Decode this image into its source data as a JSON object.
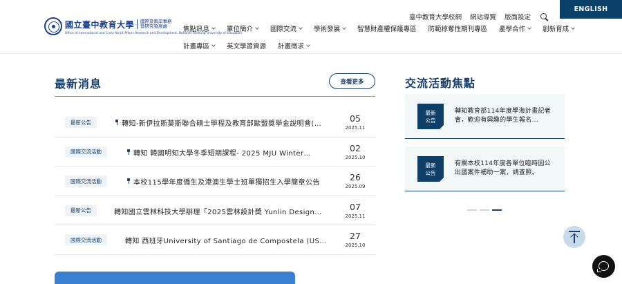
{
  "header": {
    "logo": {
      "name_cn": "國立臺中教育大學",
      "sub_line1": "國際及兩岸事務",
      "sub_line2": "暨研究發展處",
      "name_en": "Office of International and Cross-Strait Affairs Research and Development, National Taichung University of Education"
    },
    "utility_links": [
      "臺中教育大學校網",
      "網站導覽",
      "版面設定"
    ],
    "search_icon": "search-icon",
    "english_label": "ENGLISH",
    "nav_row1": [
      {
        "label": "焦點訊息",
        "dropdown": true
      },
      {
        "label": "單位簡介",
        "dropdown": true
      },
      {
        "label": "國際交流",
        "dropdown": true
      },
      {
        "label": "學術發展",
        "dropdown": true
      },
      {
        "label": "智慧財產權保護專區",
        "dropdown": false
      },
      {
        "label": "防範掠奪性期刊專區",
        "dropdown": false
      },
      {
        "label": "產學合作",
        "dropdown": true
      },
      {
        "label": "創新育成",
        "dropdown": true
      }
    ],
    "nav_row2": [
      {
        "label": "計畫專區",
        "dropdown": true
      },
      {
        "label": "英文學習資源",
        "dropdown": false
      },
      {
        "label": "計畫徵求",
        "dropdown": true
      }
    ]
  },
  "news": {
    "title": "最新消息",
    "more_label": "查看更多",
    "items": [
      {
        "badge": "最新公告",
        "pinned": true,
        "text": "轉知-新伊拉斯莫斯聯合碩士學程及教育部歐盟獎學金說明會(…",
        "day": "05",
        "ym": "2025.11"
      },
      {
        "badge": "國際交流活動",
        "pinned": true,
        "text": "轉知 韓國明知大學冬季短期課程- 2025 MJU Winter…",
        "day": "02",
        "ym": "2025.10"
      },
      {
        "badge": "國際交流活動",
        "pinned": true,
        "text": "本校115學年度僑生及港澳生學士班單獨招生入學簡章公告",
        "day": "26",
        "ym": "2025.09"
      },
      {
        "badge": "最新公告",
        "pinned": false,
        "text": "轉知國立雲林科技大學辦理「2025雲林設計獎 Yunlin Design…",
        "day": "07",
        "ym": "2025.11"
      },
      {
        "badge": "國際交流活動",
        "pinned": false,
        "text": "轉知 西班牙University of Santiago de Compostela (US…",
        "day": "27",
        "ym": "2025.10"
      }
    ]
  },
  "exchange": {
    "title": "交流活動焦點",
    "cards": [
      {
        "badge_line1": "最新",
        "badge_line2": "公告",
        "text": "轉知教育部114年度學海計畫記者會，歡迎有興趣的學生報名…"
      },
      {
        "badge_line1": "最新",
        "badge_line2": "公告",
        "text": "有關本校114年度各單位臨時因公出國案件補助一案，請查照。"
      }
    ],
    "carousel_active_index": 2,
    "carousel_count": 3
  },
  "widgets": {
    "back_to_top_icon": "arrow-up-icon",
    "chat_icon": "chat-bubble-icon"
  },
  "colors": {
    "brand_navy": "#1b3f6b",
    "english_bg": "#0b4168",
    "badge_bg": "#0f3e66",
    "card_bg": "#f2f8f8",
    "banner_blue": "#3b7fd0"
  }
}
